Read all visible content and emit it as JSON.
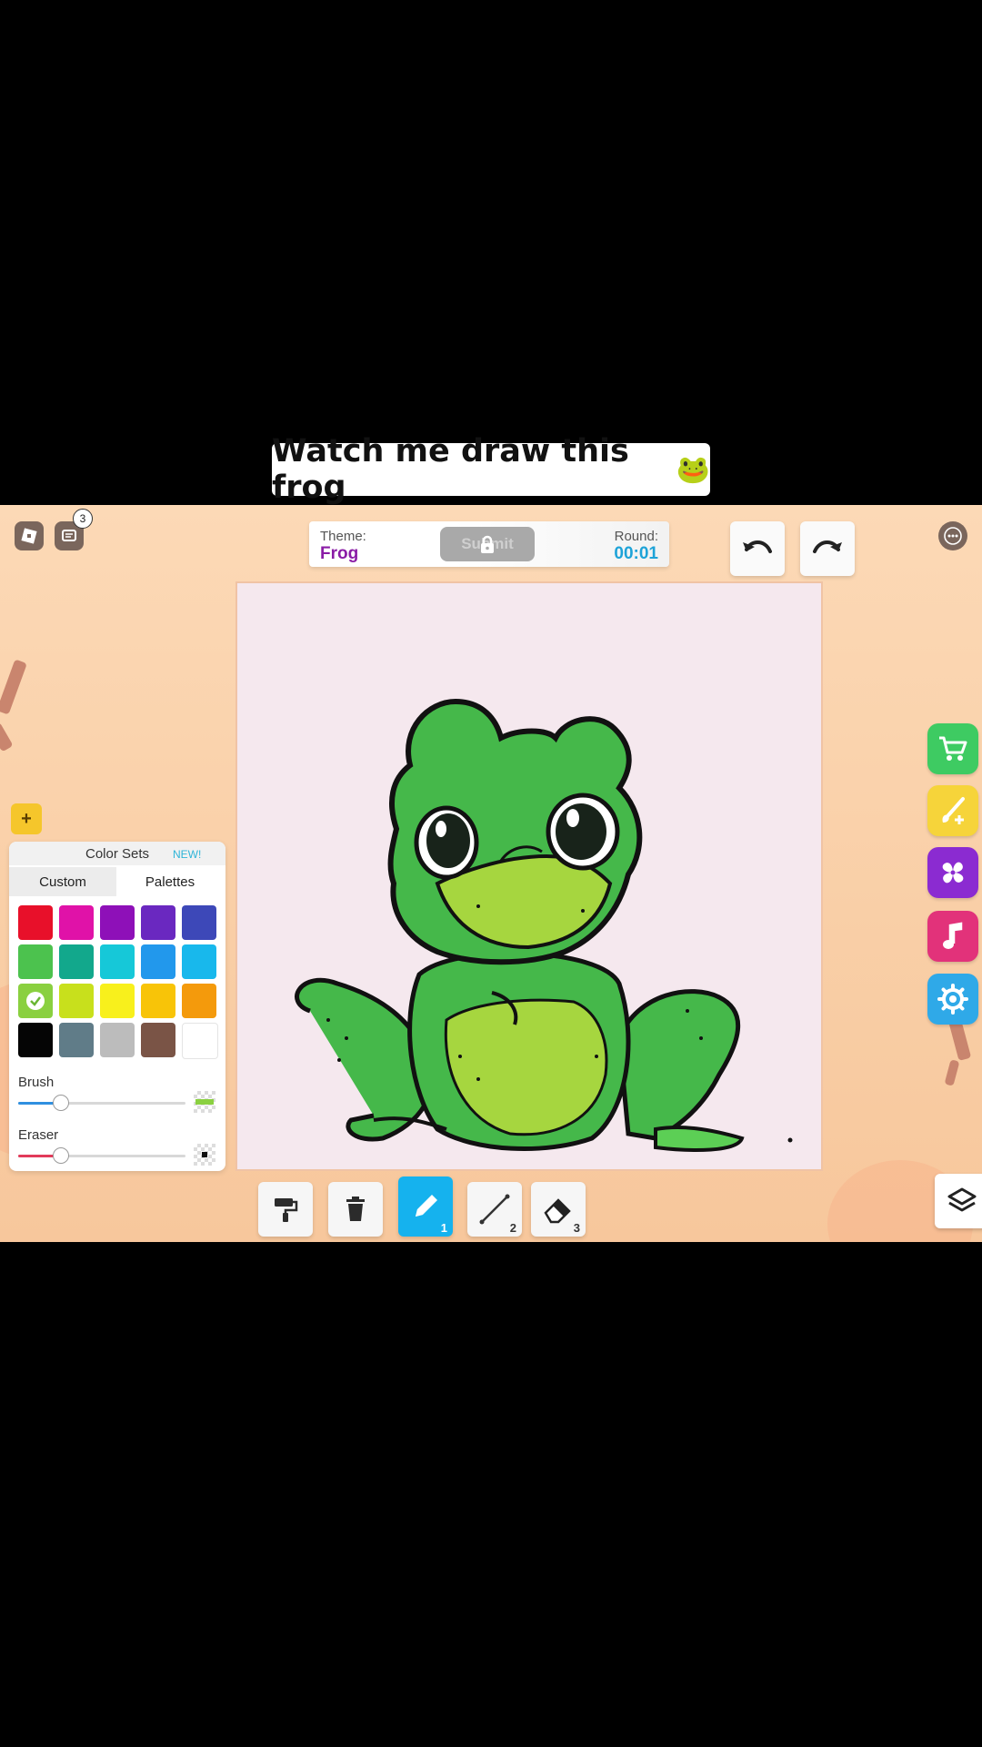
{
  "caption": {
    "text": "Watch me draw this frog",
    "emoji": "🐸"
  },
  "topbar": {
    "notification_count": "3"
  },
  "round_info": {
    "theme_label": "Theme:",
    "theme_value": "Frog",
    "submit_label": "Submit",
    "round_label": "Round:",
    "round_value": "00:01"
  },
  "color_panel": {
    "add_label": "+",
    "title": "Color Sets",
    "new_badge": "NEW!",
    "tabs": [
      "Custom",
      "Palettes"
    ],
    "selected_tab": "Palettes",
    "swatches": [
      "#e8102a",
      "#e012a8",
      "#8e10b8",
      "#6a28c0",
      "#3d48b8",
      "#4cc24e",
      "#12a88c",
      "#16c8d8",
      "#2298ec",
      "#18b8ec",
      "#8ad040",
      "#c8e01c",
      "#f8f01c",
      "#f8c408",
      "#f49a0c",
      "#050505",
      "#607c88",
      "#bcbcbc",
      "#7a5446",
      "#ffffff"
    ],
    "selected_swatch": "#8ad040",
    "brush_label": "Brush",
    "brush_value": 0.25,
    "eraser_label": "Eraser",
    "eraser_value": 0.25
  },
  "tools": {
    "active": "pencil",
    "pencil_key": "1",
    "line_key": "2",
    "eraser_key": "3"
  },
  "side_menu": {
    "colors": {
      "shop": "#3ecb62",
      "brushes": "#f6d43a",
      "fan": "#8b2bd1",
      "music": "#e2327a",
      "settings": "#2fa9e8"
    }
  }
}
